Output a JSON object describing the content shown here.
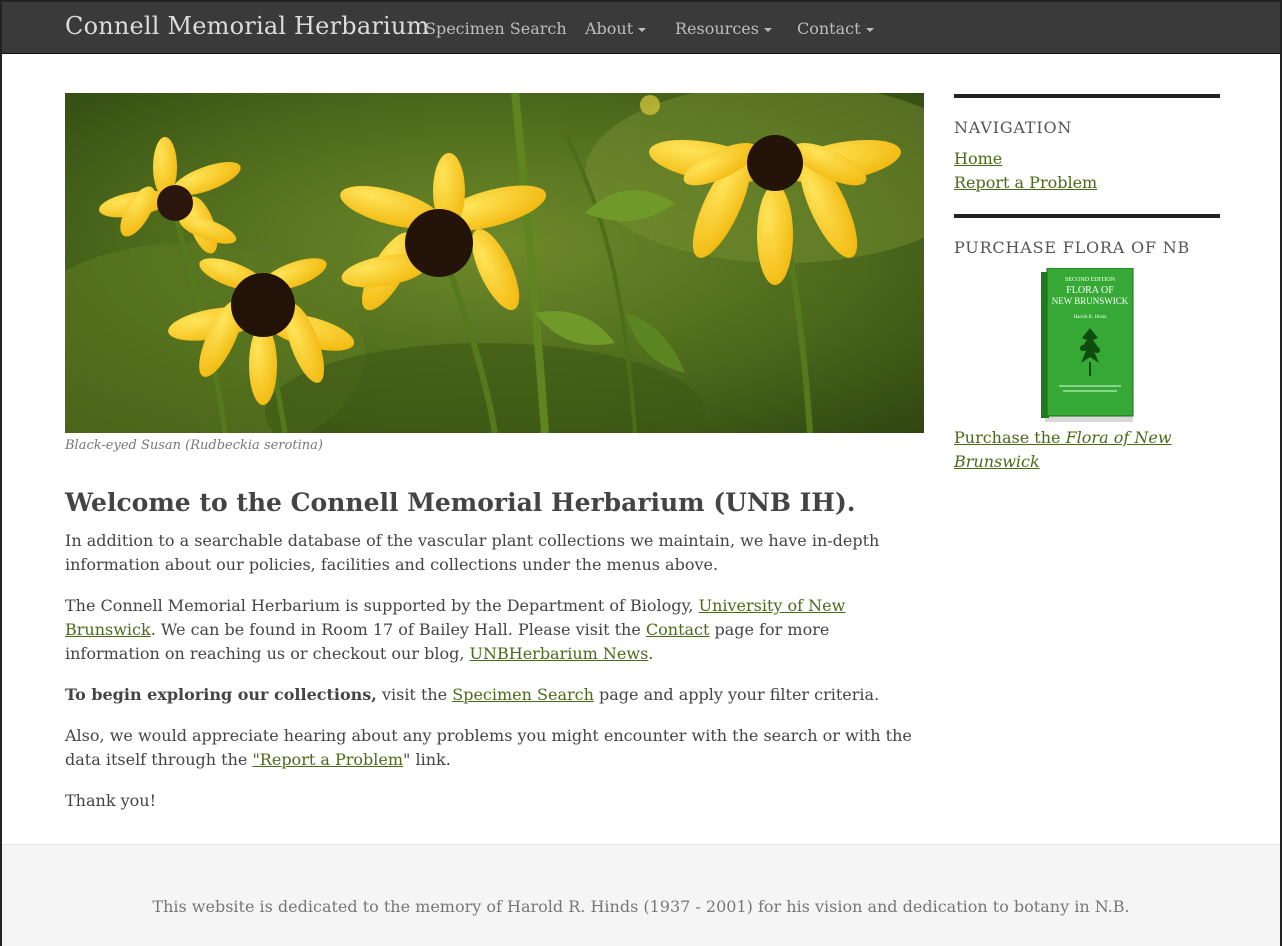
{
  "navbar": {
    "brand": "Connell Memorial Herbarium",
    "items": [
      {
        "label": "Specimen Search",
        "dropdown": false
      },
      {
        "label": "About",
        "dropdown": true
      },
      {
        "label": "Resources",
        "dropdown": true
      },
      {
        "label": "Contact",
        "dropdown": true
      }
    ]
  },
  "hero": {
    "caption": "Black-eyed Susan (Rudbeckia serotina)"
  },
  "main": {
    "title": "Welcome to the Connell Memorial Herbarium (UNB IH).",
    "p1": "In addition to a searchable database of the vascular plant collections we maintain, we have in-depth information about our policies, facilities and collections under the menus above.",
    "p2": {
      "a": "The Connell Memorial Herbarium is supported by the Department of Biology, ",
      "link1": "University of New Brunswick",
      "b": ". We can be found in Room 17 of Bailey Hall. Please visit the ",
      "link2": "Contact",
      "c": " page for more information on reaching us or checkout our blog, ",
      "link3": "UNBHerbarium News",
      "d": "."
    },
    "p3": {
      "bold": "To begin exploring our collections,",
      "a": " visit the ",
      "link": "Specimen Search",
      "b": " page and apply your filter criteria."
    },
    "p4": {
      "a": "Also, we would appreciate hearing about any problems you might encounter with the search or with the data itself through the ",
      "link": "\"Report a Problem",
      "b": "\" link."
    },
    "p5": "Thank you!"
  },
  "sidebar": {
    "nav_heading": "NAVIGATION",
    "nav_links": [
      "Home",
      "Report a Problem"
    ],
    "purchase_heading": "PURCHASE FLORA OF NB",
    "book_cover": {
      "edition": "SECOND EDITION",
      "title_line1": "FLORA OF",
      "title_line2": "NEW BRUNSWICK",
      "author": "Harold R. Hinds"
    },
    "purchase_link_a": "Purchase the ",
    "purchase_link_b": "Flora of New Brunswick"
  },
  "footer": {
    "text": "This website is dedicated to the memory of Harold R. Hinds (1937 - 2001) for his vision and dedication to botany in N.B."
  },
  "colors": {
    "navbar_bg": "#3a3a3a",
    "link": "#4b6a17",
    "footer_bg": "#f5f5f5",
    "book_green": "#2f9a2f"
  }
}
